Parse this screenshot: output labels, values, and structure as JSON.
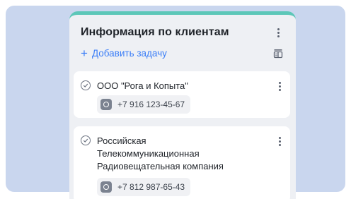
{
  "panel": {
    "title": "Информация по клиентам",
    "add_task_label": "Добавить задачу",
    "add_task_symbol": "+",
    "accent_color": "#5cc7b8",
    "link_color": "#3b7ef7"
  },
  "clients": [
    {
      "name": "ООО \"Рога и Копыта\"",
      "phone": "+7 916 123-45-67"
    },
    {
      "name": "Российская Телекоммуникационная Радиовещательная компания",
      "phone": "+7 812 987-65-43"
    }
  ],
  "icons": {
    "header_menu": "kebab-menu-icon",
    "filter": "filter-list-icon",
    "task_status": "check-circle-icon",
    "contact": "phone-icon"
  }
}
